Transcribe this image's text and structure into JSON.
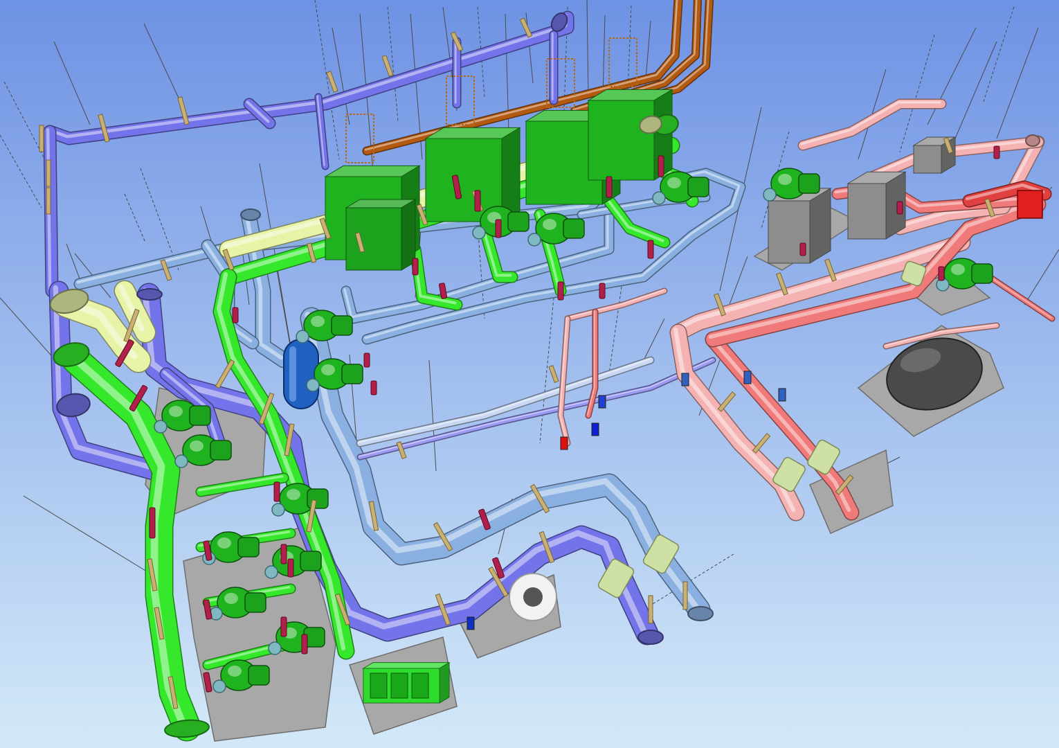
{
  "viewport": {
    "background_top": "#6e92e4",
    "background_bottom": "#d3e9f8"
  },
  "colors": {
    "chilled_supply": "#7474ea",
    "chilled_return": "#8ab0e2",
    "condenser": "#35e82c",
    "condenser_light": "#e7f3a6",
    "hot_supply": "#f07a7a",
    "hot_return": "#f5b2b2",
    "steam": "#b35a12",
    "equipment_green": "#1fb41f",
    "equipment_grey": "#8d8d8d",
    "expansion_tank": "#2060c0",
    "pad": "#a8a8a8",
    "hanger_band": "#c9b074",
    "flange": "#b0204a",
    "insulation": "#cfe0a4"
  },
  "equipment": {
    "chillers": 4,
    "boilers": 2,
    "condenser_pumps": 4,
    "chilled_pumps": 2
  }
}
